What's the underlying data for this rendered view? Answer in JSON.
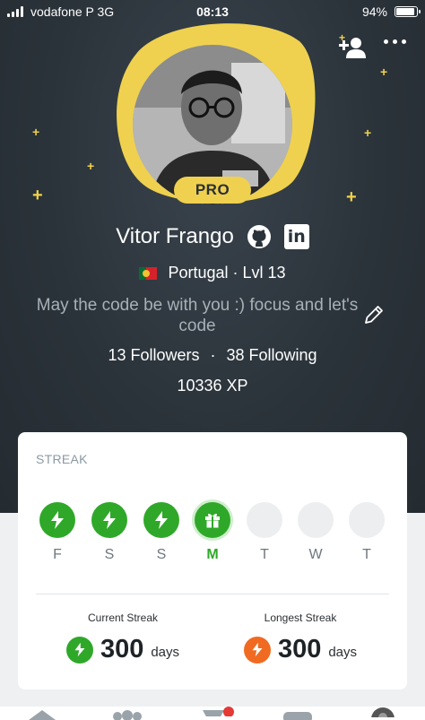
{
  "status_bar": {
    "carrier": "vodafone P  3G",
    "time": "08:13",
    "battery": "94%",
    "battery_level": 0.94
  },
  "header": {
    "add_friend_icon": "add-user-icon",
    "more_icon": "more-icon"
  },
  "profile": {
    "badge": "PRO",
    "name": "Vitor Frango",
    "linkedin_glyph": "in",
    "country": "Portugal",
    "level": "Lvl 13",
    "country_level_separator": "·",
    "bio": "May the code be with you :) focus and let's code",
    "followers": "13 Followers",
    "follow_separator": "·",
    "following": "38 Following",
    "xp": "10336 XP"
  },
  "streak": {
    "title": "STREAK",
    "days": [
      {
        "label": "F",
        "state": "done",
        "icon": "bolt-icon"
      },
      {
        "label": "S",
        "state": "done",
        "icon": "bolt-icon"
      },
      {
        "label": "S",
        "state": "done",
        "icon": "bolt-icon"
      },
      {
        "label": "M",
        "state": "today",
        "icon": "gift-icon"
      },
      {
        "label": "T",
        "state": "empty"
      },
      {
        "label": "W",
        "state": "empty"
      },
      {
        "label": "T",
        "state": "empty"
      }
    ],
    "current": {
      "label": "Current Streak",
      "value": "300",
      "unit": "days",
      "color": "#2fa829"
    },
    "longest": {
      "label": "Longest Streak",
      "value": "300",
      "unit": "days",
      "color": "#f06a21"
    }
  },
  "colors": {
    "accent_gold": "#efd14f",
    "green": "#2fa829",
    "orange": "#f06a21",
    "hero_bg": "#2b333a"
  }
}
